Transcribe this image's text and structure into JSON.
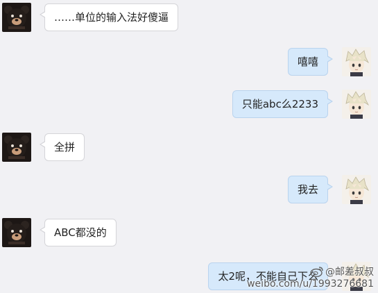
{
  "messages": [
    {
      "side": "in",
      "text": "……单位的输入法好傻逼"
    },
    {
      "side": "out",
      "text": "嘻嘻"
    },
    {
      "side": "out",
      "text": "只能abc么2233"
    },
    {
      "side": "in",
      "text": "全拼"
    },
    {
      "side": "out",
      "text": "我去"
    },
    {
      "side": "in",
      "text": "ABC都没的"
    },
    {
      "side": "out",
      "text": "太2呢，不能自己下么"
    }
  ],
  "watermark": {
    "handle": "@邮差叔叔",
    "url": "weibo.com/u/1993276681"
  },
  "colors": {
    "background": "#f1f1f4",
    "incoming_bubble": "#ffffff",
    "outgoing_bubble": "#d6e9fb"
  },
  "icons": {
    "incoming_avatar": "dark-bear-avatar",
    "outgoing_avatar": "blond-anime-boy-avatar",
    "watermark_logo": "weibo-logo-icon"
  }
}
